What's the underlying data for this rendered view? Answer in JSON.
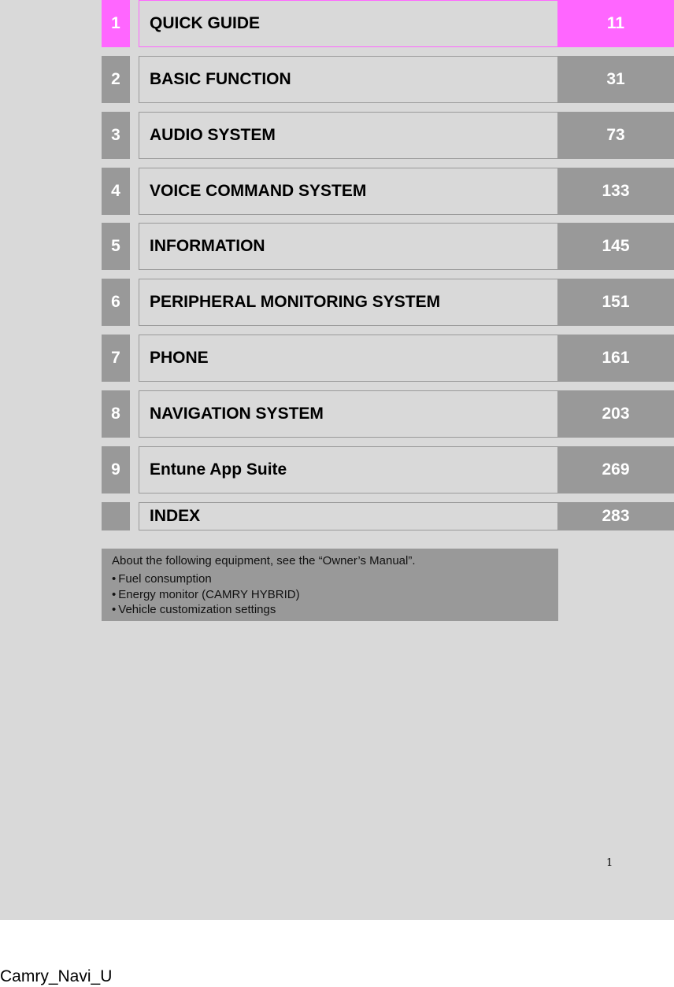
{
  "toc": {
    "accent_color": "#ff66ff",
    "neutral_color": "#999999",
    "chapters": [
      {
        "number": "1",
        "title": "QUICK GUIDE",
        "page": "11",
        "active": true
      },
      {
        "number": "2",
        "title": "BASIC FUNCTION",
        "page": "31"
      },
      {
        "number": "3",
        "title": "AUDIO SYSTEM",
        "page": "73"
      },
      {
        "number": "4",
        "title": "VOICE COMMAND SYSTEM",
        "page": "133"
      },
      {
        "number": "5",
        "title": "INFORMATION",
        "page": "145"
      },
      {
        "number": "6",
        "title": "PERIPHERAL MONITORING SYSTEM",
        "page": "151"
      },
      {
        "number": "7",
        "title": "PHONE",
        "page": "161"
      },
      {
        "number": "8",
        "title": "NAVIGATION SYSTEM",
        "page": "203"
      },
      {
        "number": "9",
        "title": "Entune App Suite",
        "page": "269"
      }
    ],
    "index": {
      "number": "",
      "title": "INDEX",
      "page": "283"
    }
  },
  "note": {
    "intro": "About the following equipment, see the “Owner’s Manual”.",
    "items": [
      "Fuel consumption",
      "Energy monitor (CAMRY HYBRID)",
      "Vehicle customization settings"
    ]
  },
  "page_number": "1",
  "footer_label": "Camry_Navi_U"
}
